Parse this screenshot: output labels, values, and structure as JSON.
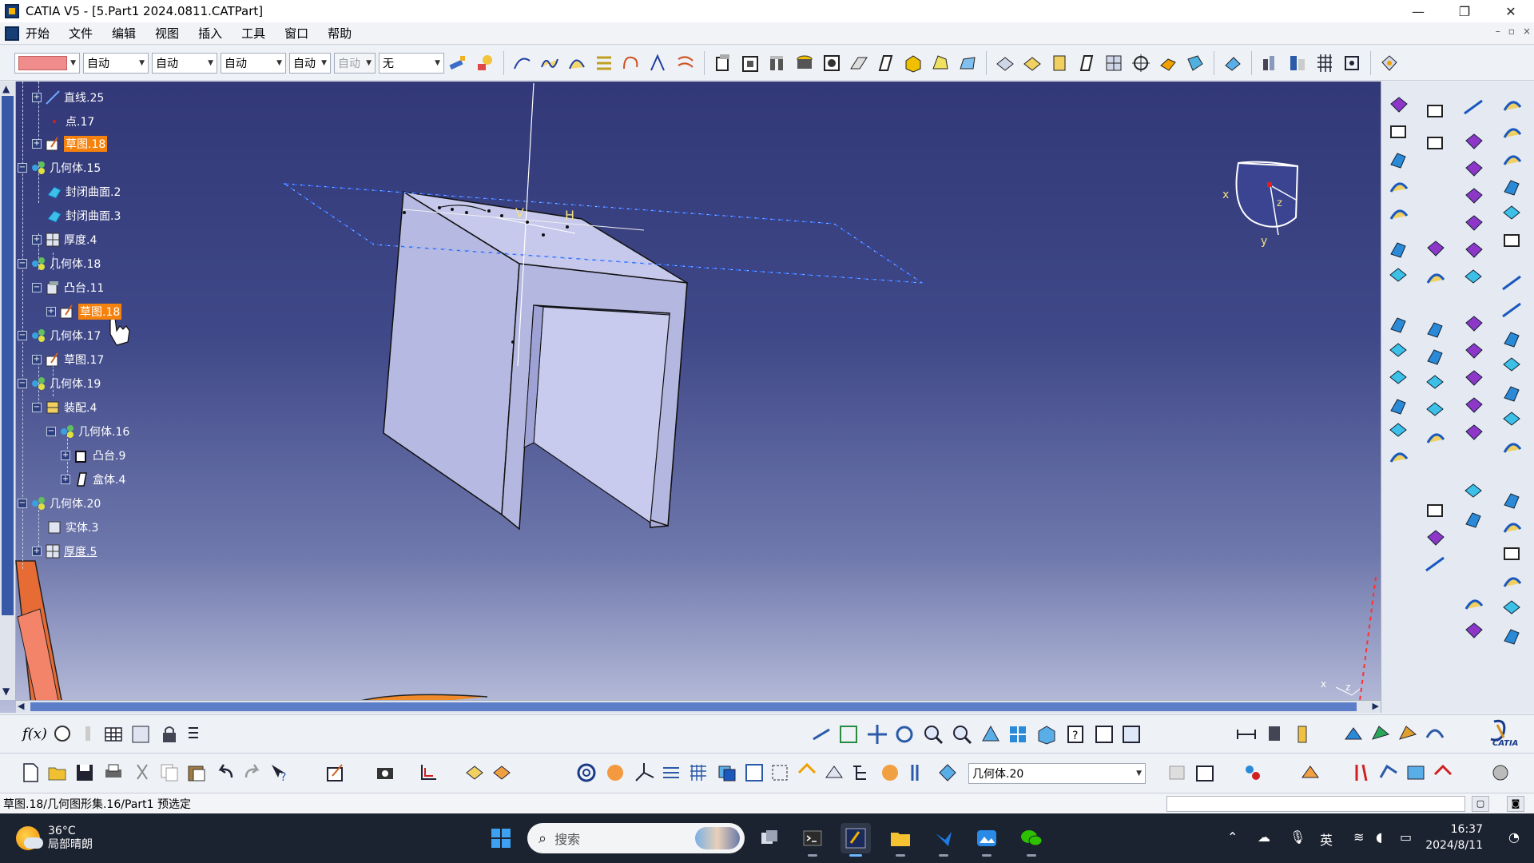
{
  "window": {
    "title": "CATIA V5 - [5.Part1 2024.0811.CATPart]",
    "controls": [
      "—",
      "❐",
      "✕"
    ]
  },
  "menu": {
    "items": [
      "开始",
      "文件",
      "编辑",
      "视图",
      "插入",
      "工具",
      "窗口",
      "帮助"
    ],
    "doc_controls": [
      "–",
      "▫",
      "×"
    ]
  },
  "toolbar_top": {
    "combos": [
      {
        "value": "自动",
        "disabled": false
      },
      {
        "value": "自动",
        "disabled": false
      },
      {
        "value": "自动",
        "disabled": false
      },
      {
        "value": "自动",
        "disabled": false
      },
      {
        "value": "自动",
        "disabled": true
      },
      {
        "value": "无",
        "disabled": false
      }
    ],
    "accent": "#f08c8c"
  },
  "spec_tree": {
    "nodes": [
      {
        "label": "直线.25",
        "icon": "line-icon",
        "state": ""
      },
      {
        "label": "点.17",
        "icon": "point-icon",
        "state": ""
      },
      {
        "label": "草图.18",
        "icon": "sketch-icon",
        "state": "selected"
      },
      {
        "label": "几何体.15",
        "icon": "geometric-set-icon",
        "state": ""
      },
      {
        "label": "封闭曲面.2",
        "icon": "close-surface-icon",
        "state": ""
      },
      {
        "label": "封闭曲面.3",
        "icon": "close-surface-icon",
        "state": ""
      },
      {
        "label": "厚度.4",
        "icon": "thickness-icon",
        "state": ""
      },
      {
        "label": "几何体.18",
        "icon": "geometric-set-icon",
        "state": ""
      },
      {
        "label": "凸台.11",
        "icon": "pad-icon",
        "state": ""
      },
      {
        "label": "草图.18",
        "icon": "sketch-icon",
        "state": "selected"
      },
      {
        "label": "几何体.17",
        "icon": "geometric-set-icon",
        "state": ""
      },
      {
        "label": "草图.17",
        "icon": "sketch-icon",
        "state": ""
      },
      {
        "label": "几何体.19",
        "icon": "geometric-set-icon",
        "state": ""
      },
      {
        "label": "装配.4",
        "icon": "assemble-icon",
        "state": ""
      },
      {
        "label": "几何体.16",
        "icon": "geometric-set-icon",
        "state": ""
      },
      {
        "label": "凸台.9",
        "icon": "pad-icon",
        "state": ""
      },
      {
        "label": "盒体.4",
        "icon": "shell-icon",
        "state": ""
      },
      {
        "label": "几何体.20",
        "icon": "geometric-set-icon",
        "state": ""
      },
      {
        "label": "实体.3",
        "icon": "solid-icon",
        "state": ""
      },
      {
        "label": "厚度.5",
        "icon": "thickness-icon",
        "state": "underline"
      }
    ]
  },
  "viewport": {
    "sketch_axis_labels": {
      "v": "V",
      "h": "H"
    },
    "compass_labels": {
      "x": "x",
      "y": "y",
      "z": "z"
    },
    "corner_axis": {
      "x": "x",
      "z": "z"
    },
    "background_top": "#323878",
    "background_bottom": "#b9bedb",
    "part_face_color": "#c6c9ec"
  },
  "toolbar_bottom": {
    "current_body": "几何体.20",
    "fx_label": "f(x)"
  },
  "status": {
    "text": "草图.18/几何图形集.16/Part1 预选定"
  },
  "taskbar": {
    "temperature": "36°C",
    "condition": "局部晴朗",
    "search_placeholder": "搜索",
    "ime": "英",
    "time": "16:37",
    "date": "2024/8/11"
  },
  "branding": {
    "catia": "CATIA"
  }
}
